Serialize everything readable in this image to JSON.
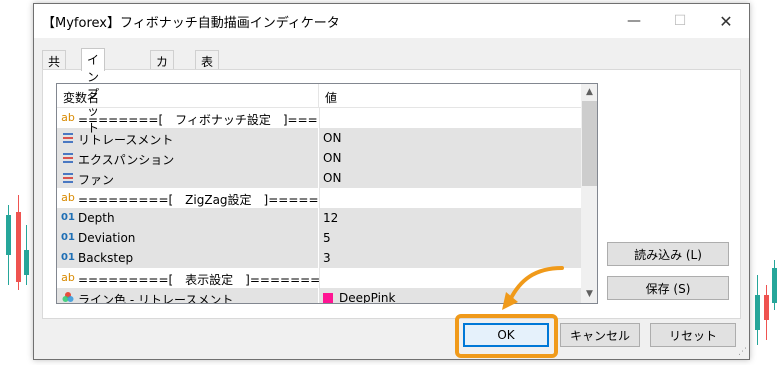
{
  "window": {
    "title": "【Myforex】フィボナッチ自動描画インディケータ",
    "minimize_icon": "minimize-icon",
    "maximize_icon": "maximize-icon",
    "close_icon": "close-icon"
  },
  "tabs": [
    {
      "label": "共有",
      "active": false
    },
    {
      "label": "インプット",
      "active": true
    },
    {
      "label": "カラー",
      "active": false
    },
    {
      "label": "表示選択",
      "active": false
    }
  ],
  "grid": {
    "col_name": "変数名",
    "col_value": "値",
    "rows": [
      {
        "icon": "ab",
        "name": "========[　フィボナッチ設定　]========",
        "value": "",
        "section": true
      },
      {
        "icon": "list",
        "name": "リトレースメント",
        "value": "ON"
      },
      {
        "icon": "list",
        "name": "エクスパンション",
        "value": "ON"
      },
      {
        "icon": "list",
        "name": "ファン",
        "value": "ON"
      },
      {
        "icon": "ab",
        "name": "=========[　ZigZag設定　]========",
        "value": "",
        "section": true
      },
      {
        "icon": "01",
        "name": "Depth",
        "value": "12"
      },
      {
        "icon": "01",
        "name": "Deviation",
        "value": "5"
      },
      {
        "icon": "01",
        "name": "Backstep",
        "value": "3"
      },
      {
        "icon": "ab",
        "name": "=========[　表示設定　]=========",
        "value": "",
        "section": true
      },
      {
        "icon": "palette",
        "name": "ライン色 - リトレースメント",
        "value": "DeepPink",
        "color": "#ff1493"
      }
    ]
  },
  "buttons": {
    "load": "読み込み (L)",
    "save": "保存 (S)",
    "ok": "OK",
    "cancel": "キャンセル",
    "reset": "リセット"
  },
  "colors": {
    "highlight": "#f09a1a",
    "ok_border": "#0078d7",
    "bull": "#26a69a",
    "bear": "#ef5350"
  }
}
